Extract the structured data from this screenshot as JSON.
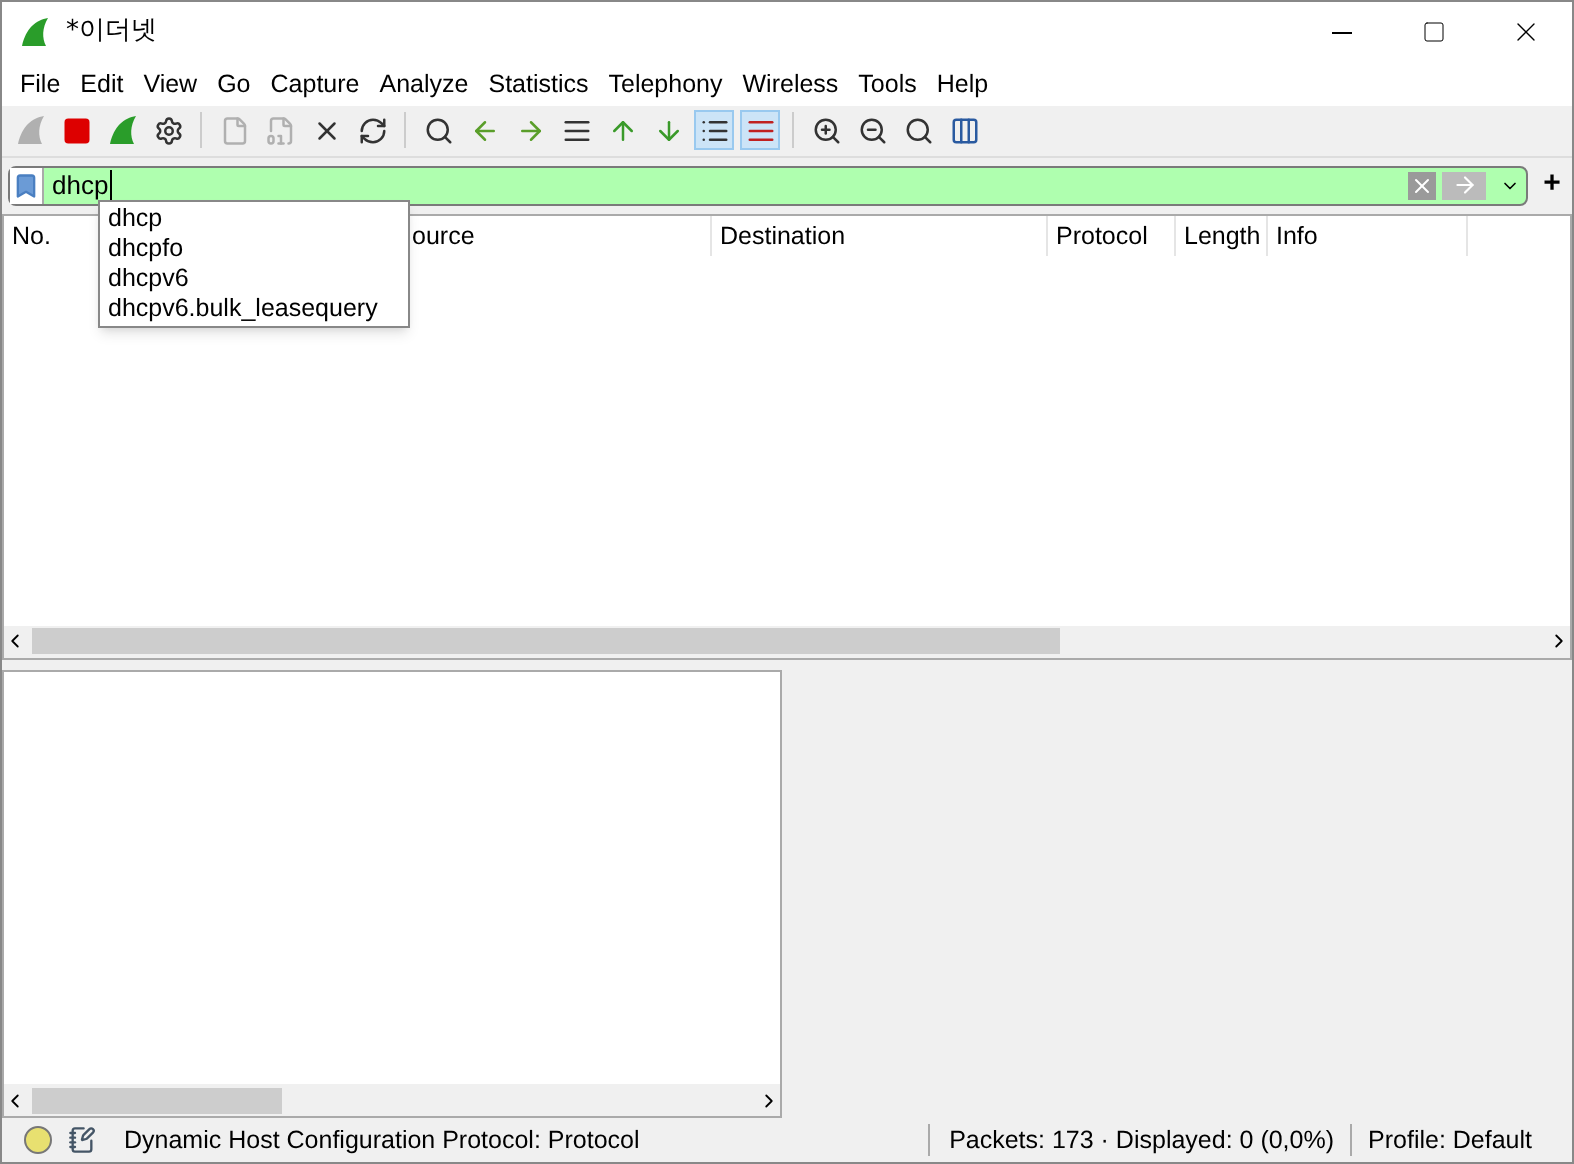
{
  "window": {
    "title": "*이더넷"
  },
  "menu": [
    "File",
    "Edit",
    "View",
    "Go",
    "Capture",
    "Analyze",
    "Statistics",
    "Telephony",
    "Wireless",
    "Tools",
    "Help"
  ],
  "toolbar": [
    {
      "kind": "fin",
      "disabled": true,
      "active": false
    },
    {
      "kind": "stop",
      "disabled": false,
      "active": false
    },
    {
      "kind": "restart",
      "disabled": false,
      "active": false
    },
    {
      "kind": "options",
      "disabled": false,
      "active": false
    },
    {
      "kind": "sep"
    },
    {
      "kind": "open",
      "disabled": true,
      "active": false
    },
    {
      "kind": "save",
      "disabled": true,
      "active": false
    },
    {
      "kind": "close",
      "disabled": false,
      "active": false
    },
    {
      "kind": "reload",
      "disabled": false,
      "active": false
    },
    {
      "kind": "sep"
    },
    {
      "kind": "find",
      "disabled": false,
      "active": false
    },
    {
      "kind": "back",
      "disabled": false,
      "active": false
    },
    {
      "kind": "forward",
      "disabled": false,
      "active": false
    },
    {
      "kind": "goto",
      "disabled": false,
      "active": false
    },
    {
      "kind": "first",
      "disabled": false,
      "active": false
    },
    {
      "kind": "last",
      "disabled": false,
      "active": false
    },
    {
      "kind": "autoscroll",
      "disabled": false,
      "active": true
    },
    {
      "kind": "colorize",
      "disabled": false,
      "active": true
    },
    {
      "kind": "sep"
    },
    {
      "kind": "zoomin",
      "disabled": false,
      "active": false
    },
    {
      "kind": "zoomout",
      "disabled": false,
      "active": false
    },
    {
      "kind": "zoomreset",
      "disabled": false,
      "active": false
    },
    {
      "kind": "resize",
      "disabled": false,
      "active": false
    }
  ],
  "filter": {
    "value": "dhcp",
    "valid": true,
    "add": "+"
  },
  "suggestions": [
    "dhcp",
    "dhcpfo",
    "dhcpv6",
    "dhcpv6.bulk_leasequery"
  ],
  "columns": [
    {
      "label": "No."
    },
    {
      "label": "ource"
    },
    {
      "label": "Destination"
    },
    {
      "label": "Protocol"
    },
    {
      "label": "Length"
    },
    {
      "label": "Info"
    }
  ],
  "status_bar": {
    "color": "#e8e070",
    "field": "Dynamic Host Configuration Protocol: Protocol",
    "packets": "Packets: 173 · Displayed: 0 (0,0%)",
    "profile": "Profile: Default"
  }
}
